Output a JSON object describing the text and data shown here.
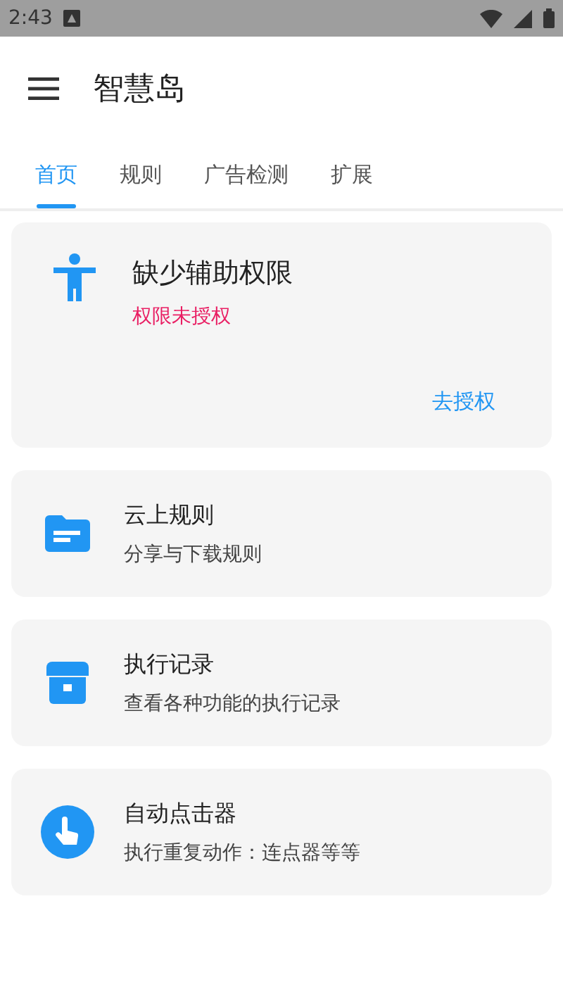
{
  "status_bar": {
    "time": "2:43"
  },
  "app_bar": {
    "title": "智慧岛"
  },
  "tabs": [
    {
      "label": "首页",
      "selected": true
    },
    {
      "label": "规则",
      "selected": false
    },
    {
      "label": "广告检测",
      "selected": false
    },
    {
      "label": "扩展",
      "selected": false
    }
  ],
  "permission_card": {
    "title": "缺少辅助权限",
    "status": "权限未授权",
    "action": "去授权"
  },
  "cards": [
    {
      "title": "云上规则",
      "subtitle": "分享与下载规则"
    },
    {
      "title": "执行记录",
      "subtitle": "查看各种功能的执行记录"
    },
    {
      "title": "自动点击器",
      "subtitle": "执行重复动作：连点器等等"
    }
  ]
}
